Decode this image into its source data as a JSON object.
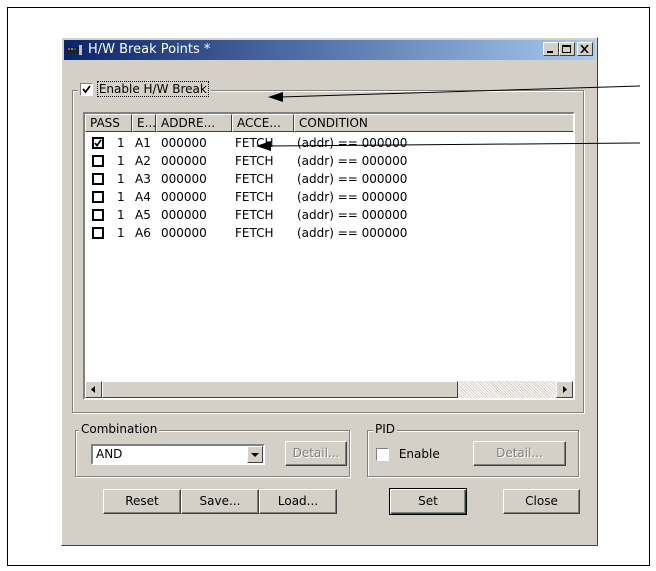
{
  "window": {
    "title": "H/W Break Points *",
    "controls": [
      "minimize-icon",
      "maximize-icon",
      "close-icon"
    ]
  },
  "enable_hw_break": {
    "label": "Enable H/W Break",
    "checked": true
  },
  "table": {
    "columns": [
      "PASS",
      "E...",
      "ADDRE...",
      "ACCE...",
      "CONDITION"
    ],
    "rows": [
      {
        "checked": true,
        "pass": "1",
        "event": "A1",
        "address": "000000",
        "access": "FETCH",
        "condition": "(addr) == 000000"
      },
      {
        "checked": false,
        "pass": "1",
        "event": "A2",
        "address": "000000",
        "access": "FETCH",
        "condition": "(addr) == 000000"
      },
      {
        "checked": false,
        "pass": "1",
        "event": "A3",
        "address": "000000",
        "access": "FETCH",
        "condition": "(addr) == 000000"
      },
      {
        "checked": false,
        "pass": "1",
        "event": "A4",
        "address": "000000",
        "access": "FETCH",
        "condition": "(addr) == 000000"
      },
      {
        "checked": false,
        "pass": "1",
        "event": "A5",
        "address": "000000",
        "access": "FETCH",
        "condition": "(addr) == 000000"
      },
      {
        "checked": false,
        "pass": "1",
        "event": "A6",
        "address": "000000",
        "access": "FETCH",
        "condition": "(addr) == 000000"
      }
    ]
  },
  "combination": {
    "label": "Combination",
    "value": "AND",
    "detail_label": "Detail..."
  },
  "pid": {
    "label": "PID",
    "enable_label": "Enable",
    "checked": false,
    "detail_label": "Detail..."
  },
  "buttons": {
    "reset": "Reset",
    "save": "Save...",
    "load": "Load...",
    "set": "Set",
    "close": "Close"
  },
  "colors": {
    "title_bar_start": "#0a246a",
    "title_bar_end": "#a6caf0",
    "dialog_face": "#d4d0c8"
  }
}
